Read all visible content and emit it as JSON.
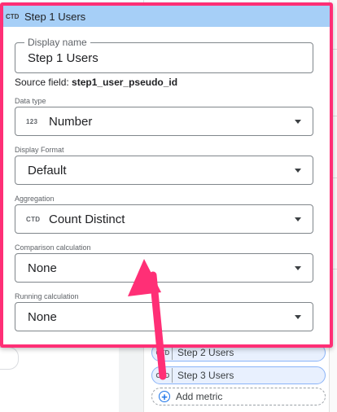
{
  "popup": {
    "header": {
      "badge": "CTD",
      "title": "Step 1 Users"
    },
    "display_name": {
      "label": "Display name",
      "value": "Step 1 Users"
    },
    "source_field": {
      "prefix": "Source field:",
      "value": "step1_user_pseudo_id"
    },
    "data_type": {
      "label": "Data type",
      "icon": "123",
      "value": "Number"
    },
    "display_format": {
      "label": "Display Format",
      "value": "Default"
    },
    "aggregation": {
      "label": "Aggregation",
      "icon": "CTD",
      "value": "Count Distinct"
    },
    "comparison_calculation": {
      "label": "Comparison calculation",
      "value": "None"
    },
    "running_calculation": {
      "label": "Running calculation",
      "value": "None"
    }
  },
  "metrics_list": {
    "items": [
      {
        "badge": "CTD",
        "label": "Step 2 Users"
      },
      {
        "badge": "CTD",
        "label": "Step 3 Users"
      }
    ],
    "add_label": "Add metric"
  },
  "colors": {
    "highlight": "#ff2f76",
    "header_bg": "#a6cff7",
    "chip_bg": "#e8f0fe",
    "accent": "#1a73e8"
  },
  "icons": {
    "dropdown": "caret-down-icon",
    "add": "add-circle-icon"
  }
}
